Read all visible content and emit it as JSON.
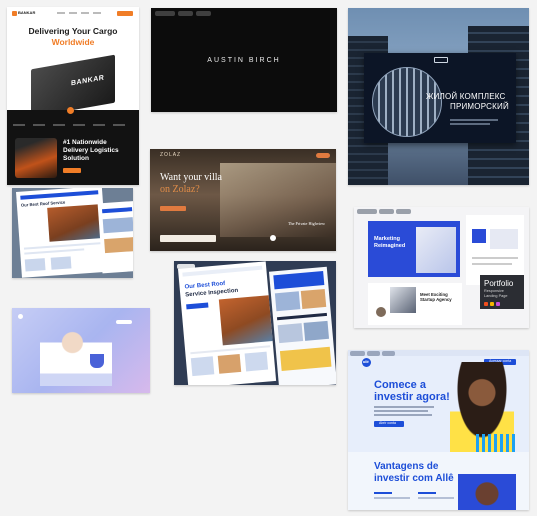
{
  "colors": {
    "background": "#f3f3f3",
    "orange": "#f07d27",
    "blue": "#2a4bd7",
    "navy": "#0c1526"
  },
  "cards": {
    "cargo": {
      "brand": "BANKAR",
      "headline_line1": "Delivering Your Cargo",
      "headline_line2": "Worldwide",
      "container_brand": "BANKAR",
      "rank_line1": "#1 Nationwide",
      "rank_line2": "Delivery Logistics",
      "rank_line3": "Solution"
    },
    "austin": {
      "title": "AUSTIN BIRCH"
    },
    "complex": {
      "line1": "ЖИЛОЙ КОМПЛЕКС",
      "line2": "ПРИМОРСКИЙ"
    },
    "villa": {
      "brand": "ZOLAZ",
      "headline_line1": "Want your villa",
      "headline_line2": "on Zolaz?",
      "caption": "The Private Highview"
    },
    "roof_small": {
      "headline": "Our Best Roof Service"
    },
    "roof_large": {
      "headline_line1": "Our Best Roof",
      "headline_line2": "Service Inspection"
    },
    "portfolio": {
      "marketing_line1": "Marketing",
      "marketing_line2": "Reimagined",
      "agency_line1": "Meet Exciting",
      "agency_line2": "Startup Agency",
      "title": "Portfolio",
      "subtitle_line1": "Responsive",
      "subtitle_line2": "Landing Page"
    },
    "invest": {
      "logo": "allê",
      "cta_top": "Acessar conta",
      "headline_line1": "Comece a",
      "headline_line2": "investir agora!",
      "cta_button": "Abrir conta",
      "section_line1": "Vantagens de",
      "section_line2": "investir com Allê"
    }
  }
}
